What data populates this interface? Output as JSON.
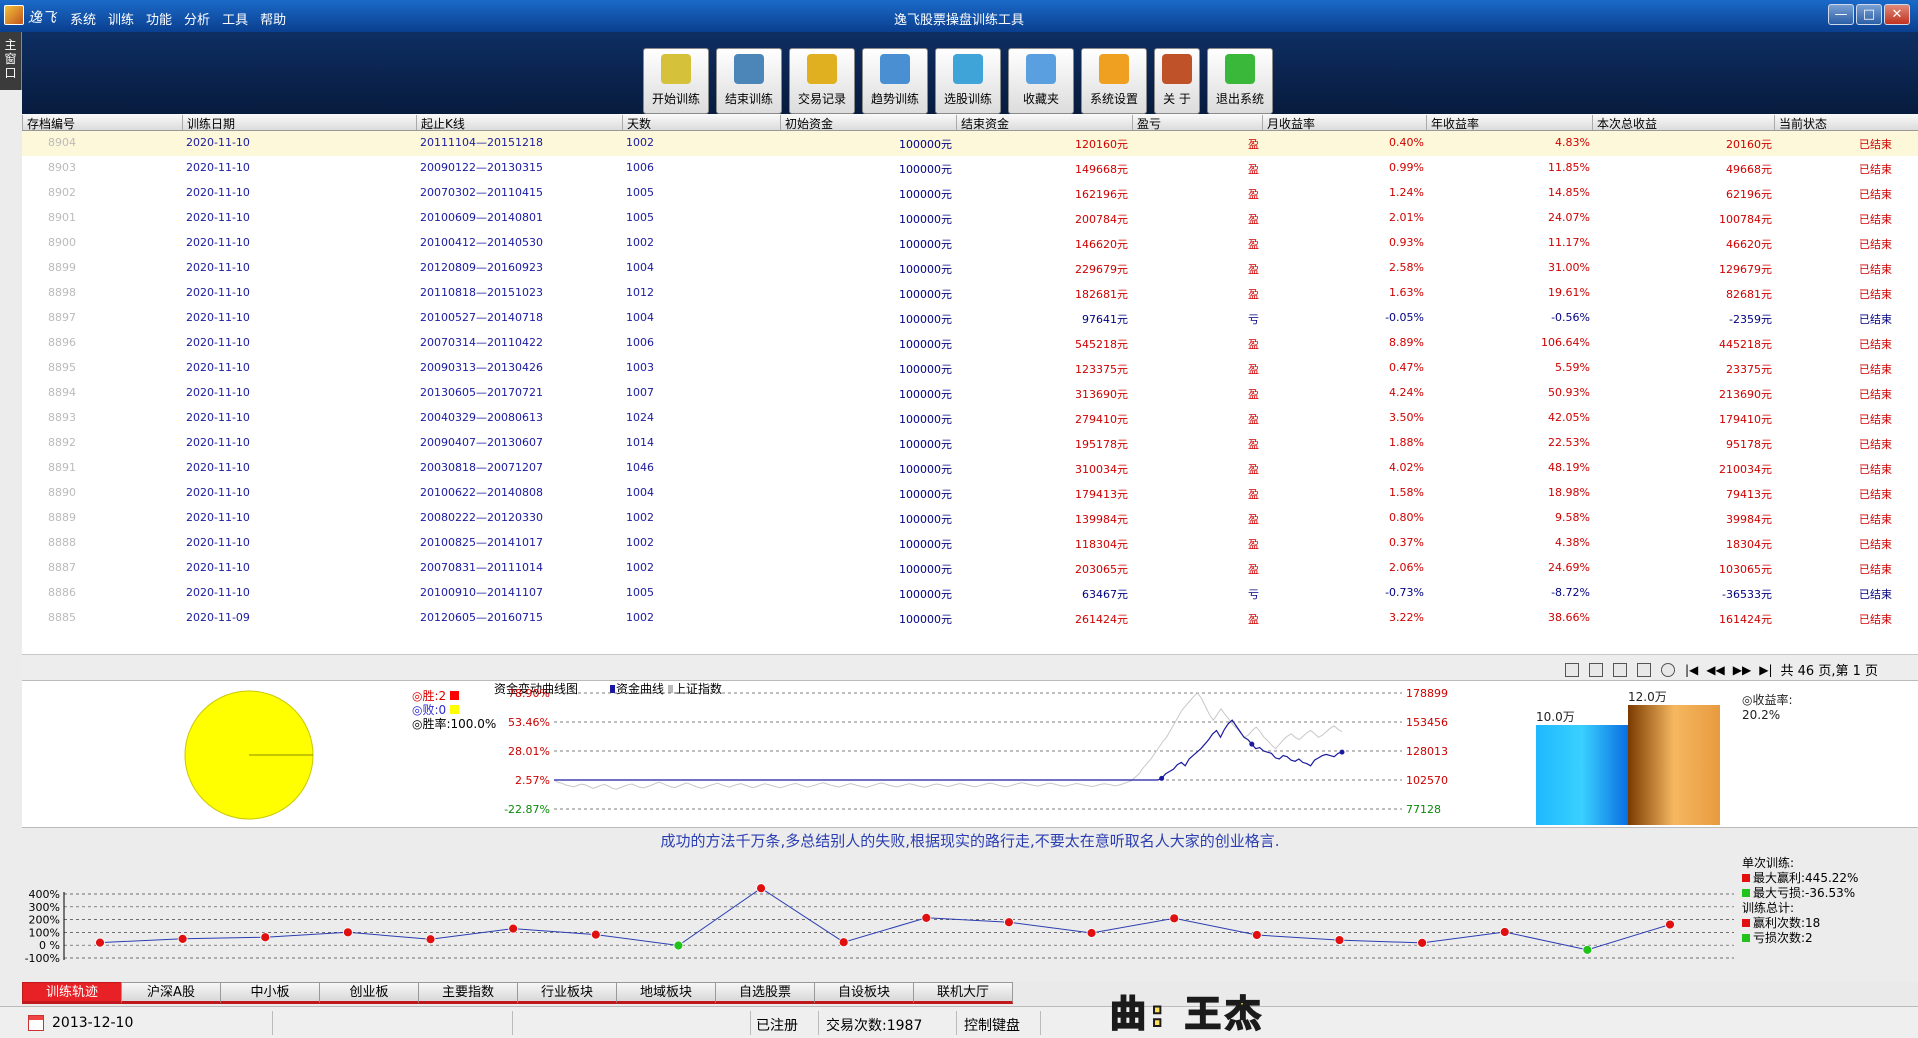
{
  "window": {
    "brand": "逸飞",
    "title": "逸飞股票操盘训练工具",
    "minimize": "—",
    "maximize": "□",
    "close": "✕"
  },
  "menu": [
    "系统",
    "训练",
    "功能",
    "分析",
    "工具",
    "帮助"
  ],
  "side_tab": "主窗口",
  "toolbar": [
    {
      "label": "开始训练",
      "icon": "start-training-icon",
      "color": "#d6c23a"
    },
    {
      "label": "结束训练",
      "icon": "end-training-icon",
      "color": "#4c86b8"
    },
    {
      "label": "交易记录",
      "icon": "trade-record-icon",
      "color": "#e0b020"
    },
    {
      "label": "趋势训练",
      "icon": "trend-training-icon",
      "color": "#4a8fd2"
    },
    {
      "label": "选股训练",
      "icon": "stock-pick-icon",
      "color": "#3fa4d8"
    },
    {
      "label": "收藏夹",
      "icon": "favorites-icon",
      "color": "#5aa0e0"
    },
    {
      "label": "系统设置",
      "icon": "settings-gear-icon",
      "color": "#f0a020"
    },
    {
      "label": "关 于",
      "icon": "about-people-icon",
      "color": "#c0522a"
    },
    {
      "label": "退出系统",
      "icon": "exit-arrow-icon",
      "color": "#3ab83a"
    }
  ],
  "table": {
    "columns": [
      "存档编号",
      "训练日期",
      "起止K线",
      "天数",
      "初始资金",
      "结束资金",
      "盈亏",
      "月收益率",
      "年收益率",
      "本次总收益",
      "当前状态"
    ],
    "rows": [
      [
        "8904",
        "2020-11-10",
        "20111104—20151218",
        "1002",
        "100000元",
        "120160元",
        "盈",
        "0.40%",
        "4.83%",
        "20160元",
        "已结束"
      ],
      [
        "8903",
        "2020-11-10",
        "20090122—20130315",
        "1006",
        "100000元",
        "149668元",
        "盈",
        "0.99%",
        "11.85%",
        "49668元",
        "已结束"
      ],
      [
        "8902",
        "2020-11-10",
        "20070302—20110415",
        "1005",
        "100000元",
        "162196元",
        "盈",
        "1.24%",
        "14.85%",
        "62196元",
        "已结束"
      ],
      [
        "8901",
        "2020-11-10",
        "20100609—20140801",
        "1005",
        "100000元",
        "200784元",
        "盈",
        "2.01%",
        "24.07%",
        "100784元",
        "已结束"
      ],
      [
        "8900",
        "2020-11-10",
        "20100412—20140530",
        "1002",
        "100000元",
        "146620元",
        "盈",
        "0.93%",
        "11.17%",
        "46620元",
        "已结束"
      ],
      [
        "8899",
        "2020-11-10",
        "20120809—20160923",
        "1004",
        "100000元",
        "229679元",
        "盈",
        "2.58%",
        "31.00%",
        "129679元",
        "已结束"
      ],
      [
        "8898",
        "2020-11-10",
        "20110818—20151023",
        "1012",
        "100000元",
        "182681元",
        "盈",
        "1.63%",
        "19.61%",
        "82681元",
        "已结束"
      ],
      [
        "8897",
        "2020-11-10",
        "20100527—20140718",
        "1004",
        "100000元",
        "97641元",
        "亏",
        "-0.05%",
        "-0.56%",
        "-2359元",
        "已结束"
      ],
      [
        "8896",
        "2020-11-10",
        "20070314—20110422",
        "1006",
        "100000元",
        "545218元",
        "盈",
        "8.89%",
        "106.64%",
        "445218元",
        "已结束"
      ],
      [
        "8895",
        "2020-11-10",
        "20090313—20130426",
        "1003",
        "100000元",
        "123375元",
        "盈",
        "0.47%",
        "5.59%",
        "23375元",
        "已结束"
      ],
      [
        "8894",
        "2020-11-10",
        "20130605—20170721",
        "1007",
        "100000元",
        "313690元",
        "盈",
        "4.24%",
        "50.93%",
        "213690元",
        "已结束"
      ],
      [
        "8893",
        "2020-11-10",
        "20040329—20080613",
        "1024",
        "100000元",
        "279410元",
        "盈",
        "3.50%",
        "42.05%",
        "179410元",
        "已结束"
      ],
      [
        "8892",
        "2020-11-10",
        "20090407—20130607",
        "1014",
        "100000元",
        "195178元",
        "盈",
        "1.88%",
        "22.53%",
        "95178元",
        "已结束"
      ],
      [
        "8891",
        "2020-11-10",
        "20030818—20071207",
        "1046",
        "100000元",
        "310034元",
        "盈",
        "4.02%",
        "48.19%",
        "210034元",
        "已结束"
      ],
      [
        "8890",
        "2020-11-10",
        "20100622—20140808",
        "1004",
        "100000元",
        "179413元",
        "盈",
        "1.58%",
        "18.98%",
        "79413元",
        "已结束"
      ],
      [
        "8889",
        "2020-11-10",
        "20080222—20120330",
        "1002",
        "100000元",
        "139984元",
        "盈",
        "0.80%",
        "9.58%",
        "39984元",
        "已结束"
      ],
      [
        "8888",
        "2020-11-10",
        "20100825—20141017",
        "1002",
        "100000元",
        "118304元",
        "盈",
        "0.37%",
        "4.38%",
        "18304元",
        "已结束"
      ],
      [
        "8887",
        "2020-11-10",
        "20070831—20111014",
        "1002",
        "100000元",
        "203065元",
        "盈",
        "2.06%",
        "24.69%",
        "103065元",
        "已结束"
      ],
      [
        "8886",
        "2020-11-10",
        "20100910—20141107",
        "1005",
        "100000元",
        "63467元",
        "亏",
        "-0.73%",
        "-8.72%",
        "-36533元",
        "已结束"
      ],
      [
        "8885",
        "2020-11-09",
        "20120605—20160715",
        "1002",
        "100000元",
        "261424元",
        "盈",
        "3.22%",
        "38.66%",
        "161424元",
        "已结束"
      ]
    ]
  },
  "pager": {
    "first": "|◀",
    "prev": "◀◀",
    "next": "▶▶",
    "last": "▶|",
    "info": "共 46 页,第 1 页"
  },
  "stats_legend": {
    "win": "◎胜:2",
    "lose": "◎败:0",
    "rate": "◎胜率:100.0%",
    "win_color": "#ff0000",
    "lose_color": "#ffff00"
  },
  "chart_data": [
    {
      "type": "pie",
      "title": "",
      "slices": [
        {
          "name": "胜",
          "value": 2
        },
        {
          "name": "败",
          "value": 0
        }
      ],
      "fill": "#ffff00"
    },
    {
      "type": "line",
      "title": "资金变动曲线图",
      "legend": [
        "资金曲线",
        "上证指数"
      ],
      "left_ticks": [
        "78.90%",
        "53.46%",
        "28.01%",
        "2.57%",
        "-22.87%"
      ],
      "right_ticks": [
        "178899",
        "153456",
        "128013",
        "102570",
        "77128"
      ],
      "series": [
        {
          "name": "资金曲线",
          "values": [
            102570,
            102570,
            102570,
            102570,
            102570,
            102570,
            102570,
            102570,
            102570,
            102570,
            102570,
            102570,
            102570,
            102570,
            102570,
            102570,
            102570,
            102570,
            102570,
            102570,
            102570,
            102570,
            102570,
            102570,
            102570,
            102570,
            102570,
            102570,
            102570,
            102570,
            102570,
            102570,
            102570,
            102570,
            102570,
            102570,
            102570,
            102570,
            102570,
            102570,
            102570,
            102570,
            102570,
            102570,
            102570,
            102570,
            102570,
            102570,
            102570,
            102570,
            102570,
            102570,
            102570,
            102570,
            102570,
            102570,
            102570,
            102570,
            102570,
            102570,
            102570,
            102570,
            102570,
            102570,
            102570,
            102570,
            102570,
            102570,
            102570,
            102570,
            102570,
            102570,
            102570,
            102570,
            102570,
            102570,
            102570,
            102570,
            102570,
            102570,
            102570,
            102570,
            102570,
            102570,
            102570,
            102570,
            102570,
            102570,
            102570,
            102570,
            102570,
            102570,
            102570,
            102570,
            102570,
            102570,
            102570,
            102570,
            102570,
            102570,
            102570,
            102570,
            102570,
            102570,
            102570,
            102570,
            102570,
            102570,
            102570,
            102570,
            102570,
            102570,
            102570,
            102570,
            102570,
            102570,
            102570,
            102570,
            102570,
            102570,
            102570,
            102570,
            102570,
            102570,
            102570,
            102570,
            102570,
            102570,
            102570,
            102570,
            102570,
            102570,
            102570,
            102570,
            102570,
            102570,
            102570,
            102570,
            102570,
            102570,
            102570,
            102570,
            102570,
            102570,
            102570,
            102570,
            102570,
            102570,
            102570,
            102570,
            102570,
            102570,
            102570,
            102570,
            102570,
            104000,
            108000,
            110000,
            112000,
            116000,
            118000,
            115000,
            121000,
            124000,
            127000,
            130000,
            134000,
            138000,
            143000,
            146000,
            140000,
            147000,
            152000,
            155000,
            150000,
            145000,
            140000,
            138000,
            134000,
            130000,
            131000,
            128000,
            127000,
            126000,
            122000,
            121000,
            124000,
            123000,
            120000,
            119000,
            121000,
            118000,
            117000,
            115000,
            120000,
            122000,
            124000,
            125000,
            124000,
            123000,
            126000,
            127000
          ]
        },
        {
          "name": "上证指数",
          "values": [
            102570,
            100500,
            99800,
            98200,
            97400,
            96500,
            97800,
            99000,
            98300,
            96900,
            95200,
            96400,
            97900,
            98600,
            97100,
            95300,
            94500,
            95900,
            97200,
            98400,
            99100,
            97600,
            96200,
            95600,
            96800,
            98100,
            99500,
            100700,
            99300,
            97800,
            96500,
            95900,
            97300,
            98700,
            99900,
            98800,
            97300,
            96100,
            95400,
            96600,
            97800,
            98900,
            99700,
            98400,
            97100,
            96300,
            97600,
            98700,
            99300,
            98100,
            96900,
            95800,
            96900,
            98200,
            99200,
            98500,
            97400,
            96500,
            95800,
            96700,
            97900,
            98900,
            99500,
            98400,
            97200,
            96300,
            97100,
            98200,
            99300,
            100100,
            99100,
            98000,
            97200,
            96400,
            97300,
            98500,
            99400,
            98600,
            97500,
            96800,
            96100,
            97000,
            98100,
            99200,
            99900,
            98900,
            97800,
            97100,
            96500,
            97400,
            98400,
            99300,
            98700,
            97700,
            96900,
            96300,
            97200,
            98300,
            99100,
            98500,
            97600,
            96900,
            97700,
            98600,
            99400,
            98800,
            97900,
            97200,
            96600,
            97500,
            98400,
            99300,
            99800,
            98900,
            97900,
            97100,
            96600,
            97500,
            98500,
            99500,
            100200,
            99400,
            98500,
            97800,
            97200,
            98100,
            99000,
            99800,
            99200,
            98300,
            97600,
            97100,
            97900,
            98800,
            99500,
            98900,
            98000,
            97400,
            96900,
            97700,
            98600,
            99300,
            98900,
            98100,
            97400,
            98300,
            99400,
            100600,
            102000,
            105000,
            108000,
            113000,
            117000,
            121000,
            126000,
            131000,
            136000,
            140000,
            146000,
            152000,
            158000,
            164000,
            168000,
            172000,
            176000,
            178899,
            174000,
            167000,
            160000,
            155000,
            160000,
            165000,
            160000,
            156000,
            151000,
            148000,
            144000,
            140000,
            142000,
            146000,
            149000,
            145000,
            140000,
            137000,
            133000,
            130000,
            134000,
            138000,
            141000,
            143000,
            140000,
            138000,
            141000,
            144000,
            146000,
            143000,
            140000,
            142000,
            145000,
            148000,
            150000,
            147000,
            145000
          ]
        }
      ]
    },
    {
      "type": "bar",
      "categories": [
        "10.0万",
        "12.0万"
      ],
      "values": [
        10.0,
        12.0
      ],
      "value_labels": [
        "10.0万",
        "12.0万"
      ],
      "ylim": [
        0,
        12.5
      ]
    },
    {
      "type": "line",
      "title": "",
      "y_ticks": [
        "400%",
        "300%",
        "200%",
        "100%",
        "0 %",
        "-100%"
      ],
      "ylim": [
        -100,
        400
      ],
      "values": [
        20.16,
        49.67,
        62.2,
        100.78,
        46.62,
        129.68,
        82.68,
        -2.36,
        445.22,
        23.38,
        213.69,
        179.41,
        95.18,
        210.03,
        79.41,
        39.98,
        18.3,
        103.07,
        -36.53,
        161.42
      ]
    }
  ],
  "bar_side": {
    "label1": "◎收益率:",
    "label2": "20.2%"
  },
  "motto": "成功的方法千万条,多总结别人的失败,根据现实的路行走,不要太在意听取名人大家的创业格言.",
  "stats": {
    "single": "单次训练:",
    "max_gain": "最大赢利:445.22%",
    "max_loss": "最大亏损:-36.53%",
    "total": "训练总计:",
    "win_count": "赢利次数:18",
    "loss_count": "亏损次数:2",
    "gain_color": "#e01010",
    "loss_color": "#21c21a"
  },
  "tabs": [
    "训练轨迹",
    "沪深A股",
    "中小板",
    "创业板",
    "主要指数",
    "行业板块",
    "地域板块",
    "自选股票",
    "自设板块",
    "联机大厅"
  ],
  "statusbar": {
    "date": "2013-12-10",
    "registered": "已注册",
    "trades": "交易次数:1987",
    "keyboard": "控制键盘",
    "song": "曲: 王杰"
  }
}
